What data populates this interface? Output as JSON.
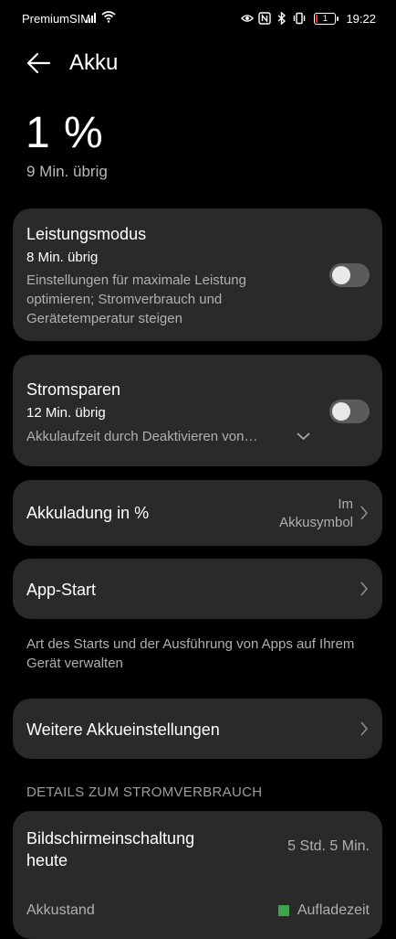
{
  "status_bar": {
    "carrier": "PremiumSIM",
    "time": "19:22",
    "battery_level_text": "1",
    "icons": [
      "signal-icon",
      "wifi-icon",
      "eye-icon",
      "nfc-icon",
      "bluetooth-icon",
      "vibrate-icon",
      "battery-icon"
    ]
  },
  "header": {
    "title": "Akku",
    "back_icon": "arrow-left-icon"
  },
  "battery": {
    "percent": "1 %",
    "remaining": "9 Min. übrig"
  },
  "performance_mode": {
    "title": "Leistungsmodus",
    "remaining": "8 Min. übrig",
    "description": "Einstellungen für maximale Leistung optimieren; Stromverbrauch und Gerätetemperatur steigen",
    "enabled": false
  },
  "power_saving": {
    "title": "Stromsparen",
    "remaining": "12 Min. übrig",
    "description": "Akkulaufzeit durch Deaktivieren von…",
    "enabled": false
  },
  "battery_percentage": {
    "title": "Akkuladung in %",
    "value_line1": "Im",
    "value_line2": "Akkusymbol"
  },
  "app_start": {
    "title": "App-Start",
    "description": "Art des Starts und der Ausführung von Apps auf Ihrem Gerät verwalten"
  },
  "more_settings": {
    "title": "Weitere Akkueinstellungen"
  },
  "details": {
    "section_title": "DETAILS ZUM STROMVERBRAUCH",
    "screen_on_label": "Bildschirmeinschaltung heute",
    "screen_on_value": "5 Std. 5 Min.",
    "battery_state_label": "Akkustand",
    "legend_label": "Aufladezeit",
    "legend_color": "#3fa34d"
  },
  "colors": {
    "background": "#000000",
    "card": "#2a2a2a",
    "toggle_off": "#5b5b5b"
  }
}
